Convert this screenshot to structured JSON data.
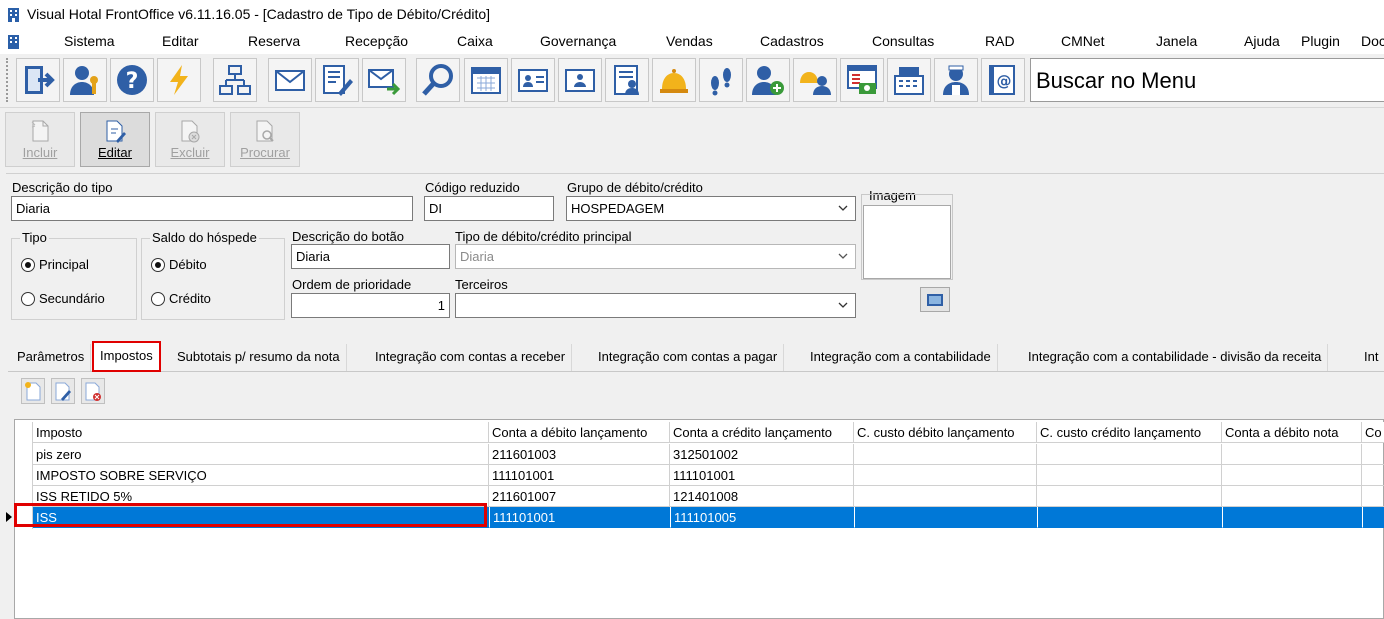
{
  "window": {
    "title": "Visual Hotal FrontOffice v6.11.16.05 - [Cadastro de Tipo de Débito/Crédito]"
  },
  "menu": [
    "Sistema",
    "Editar",
    "Reserva",
    "Recepção",
    "Caixa",
    "Governança",
    "Vendas",
    "Cadastros",
    "Consultas",
    "RAD",
    "CMNet",
    "Janela",
    "Ajuda",
    "Plugin",
    "Doc"
  ],
  "toolbar": {
    "icons": [
      "exit-icon",
      "user-key-icon",
      "help-icon",
      "lightning-icon",
      "org-chart-icon",
      "mail-icon",
      "form-edit-icon",
      "mail-send-icon",
      "search-icon",
      "calendar-icon",
      "id-card-icon",
      "id-card-2-icon",
      "report-user-icon",
      "bell-icon",
      "footprints-icon",
      "add-user-icon",
      "bell-group-icon",
      "cash-window-icon",
      "cash-register-icon",
      "maid-icon",
      "at-book-icon"
    ],
    "search_text": "Buscar no Menu"
  },
  "actions": [
    {
      "label": "Incluir",
      "enabled": false
    },
    {
      "label": "Editar",
      "enabled": true
    },
    {
      "label": "Excluir",
      "enabled": false
    },
    {
      "label": "Procurar",
      "enabled": false
    }
  ],
  "form": {
    "descricao_tipo": {
      "label": "Descrição do tipo",
      "value": "Diaria"
    },
    "codigo_reduzido": {
      "label": "Código reduzido",
      "value": "DI"
    },
    "grupo": {
      "label": "Grupo de débito/crédito",
      "value": "HOSPEDAGEM"
    },
    "imagem": {
      "label": "Imagem"
    },
    "tipo": {
      "label": "Tipo",
      "options": [
        "Principal",
        "Secundário"
      ],
      "selected": "Principal"
    },
    "saldo": {
      "label": "Saldo do hóspede",
      "options": [
        "Débito",
        "Crédito"
      ],
      "selected": "Débito"
    },
    "descricao_botao": {
      "label": "Descrição do botão",
      "value": "Diaria"
    },
    "tipo_principal": {
      "label": "Tipo de débito/crédito principal",
      "value": "Diaria"
    },
    "ordem_prioridade": {
      "label": "Ordem de prioridade",
      "value": "1"
    },
    "terceiros": {
      "label": "Terceiros",
      "value": ""
    }
  },
  "tabs": [
    "Parâmetros",
    "Impostos",
    "Subtotais p/ resumo da nota",
    "Integração com contas a receber",
    "Integração com contas a pagar",
    "Integração com a contabilidade",
    "Integração com a contabilidade - divisão da receita",
    "Int"
  ],
  "active_tab": "Impostos",
  "grid": {
    "columns": [
      "Imposto",
      "Conta a débito lançamento",
      "Conta a crédito lançamento",
      "C. custo débito lançamento",
      "C. custo crédito lançamento",
      "Conta a débito nota",
      "Co"
    ],
    "rows": [
      [
        "pis zero",
        "211601003",
        "312501002",
        "",
        "",
        "",
        ""
      ],
      [
        "IMPOSTO SOBRE SERVIÇO",
        "111101001",
        "111101001",
        "",
        "",
        "",
        ""
      ],
      [
        "ISS RETIDO 5%",
        "211601007",
        "121401008",
        "",
        "",
        "",
        ""
      ],
      [
        "ISS",
        "111101001",
        "111101005",
        "",
        "",
        "",
        ""
      ]
    ],
    "selected_row": 3
  },
  "colors": {
    "selection": "#0078d7",
    "highlight": "#e00000"
  }
}
